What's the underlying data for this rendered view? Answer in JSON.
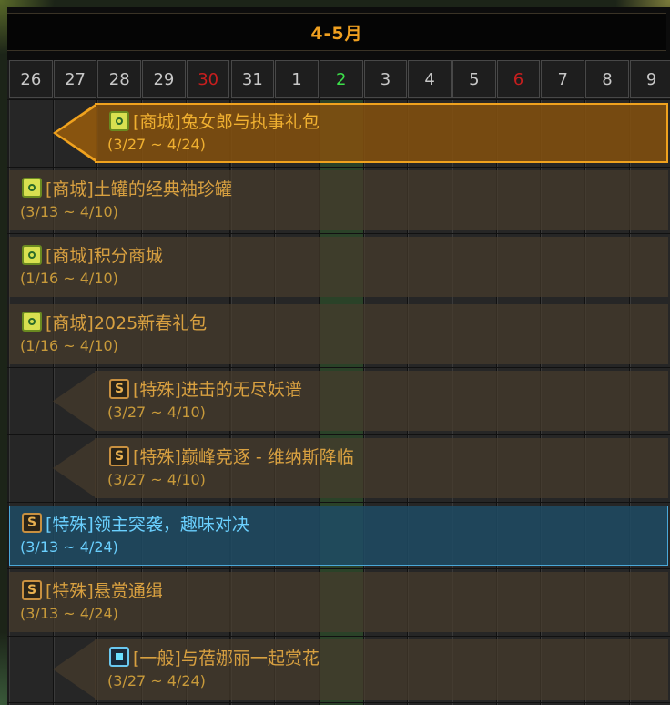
{
  "header": {
    "title": "4-5月"
  },
  "days": [
    {
      "label": "26",
      "type": "normal"
    },
    {
      "label": "27",
      "type": "normal"
    },
    {
      "label": "28",
      "type": "normal"
    },
    {
      "label": "29",
      "type": "normal"
    },
    {
      "label": "30",
      "type": "weekend"
    },
    {
      "label": "31",
      "type": "normal"
    },
    {
      "label": "1",
      "type": "normal"
    },
    {
      "label": "2",
      "type": "today"
    },
    {
      "label": "3",
      "type": "normal"
    },
    {
      "label": "4",
      "type": "normal"
    },
    {
      "label": "5",
      "type": "normal"
    },
    {
      "label": "6",
      "type": "weekend"
    },
    {
      "label": "7",
      "type": "normal"
    },
    {
      "label": "8",
      "type": "normal"
    },
    {
      "label": "9",
      "type": "normal"
    }
  ],
  "colors": {
    "title": "#f0a020",
    "weekend": "#c81e1e",
    "today": "#3ce04a",
    "event_text": "#d8a040",
    "selected_text": "#6ad0ff",
    "featured_border": "#f0a21e"
  },
  "events": [
    {
      "title": "[商城]兔女郎与执事礼包",
      "dates": "(3/27 ~ 4/24)",
      "icon": "mall-icon",
      "starts_in_view": false,
      "state": "featured"
    },
    {
      "title": "[商城]土罐的经典袖珍罐",
      "dates": "(3/13 ~ 4/10)",
      "icon": "mall-icon",
      "starts_in_view": true,
      "state": "normal"
    },
    {
      "title": "[商城]积分商城",
      "dates": "(1/16 ~ 4/10)",
      "icon": "mall-icon",
      "starts_in_view": true,
      "state": "normal"
    },
    {
      "title": "[商城]2025新春礼包",
      "dates": "(1/16 ~ 4/10)",
      "icon": "mall-icon",
      "starts_in_view": true,
      "state": "normal"
    },
    {
      "title": "[特殊]进击的无尽妖谱",
      "dates": "(3/27 ~ 4/10)",
      "icon": "special-icon",
      "icon_letter": "S",
      "starts_in_view": false,
      "state": "normal"
    },
    {
      "title": "[特殊]巅峰竞逐 - 维纳斯降临",
      "dates": "(3/27 ~ 4/10)",
      "icon": "special-icon",
      "icon_letter": "S",
      "starts_in_view": false,
      "state": "normal"
    },
    {
      "title": "[特殊]领主突袭，趣味对决",
      "dates": "(3/13 ~ 4/24)",
      "icon": "special-icon",
      "icon_letter": "S",
      "starts_in_view": true,
      "state": "selected"
    },
    {
      "title": "[特殊]悬赏通缉",
      "dates": "(3/13 ~ 4/24)",
      "icon": "special-icon",
      "icon_letter": "S",
      "starts_in_view": true,
      "state": "normal"
    },
    {
      "title": "[一般]与蓓娜丽一起赏花",
      "dates": "(3/27 ~ 4/24)",
      "icon": "general-icon",
      "starts_in_view": false,
      "state": "normal"
    }
  ]
}
